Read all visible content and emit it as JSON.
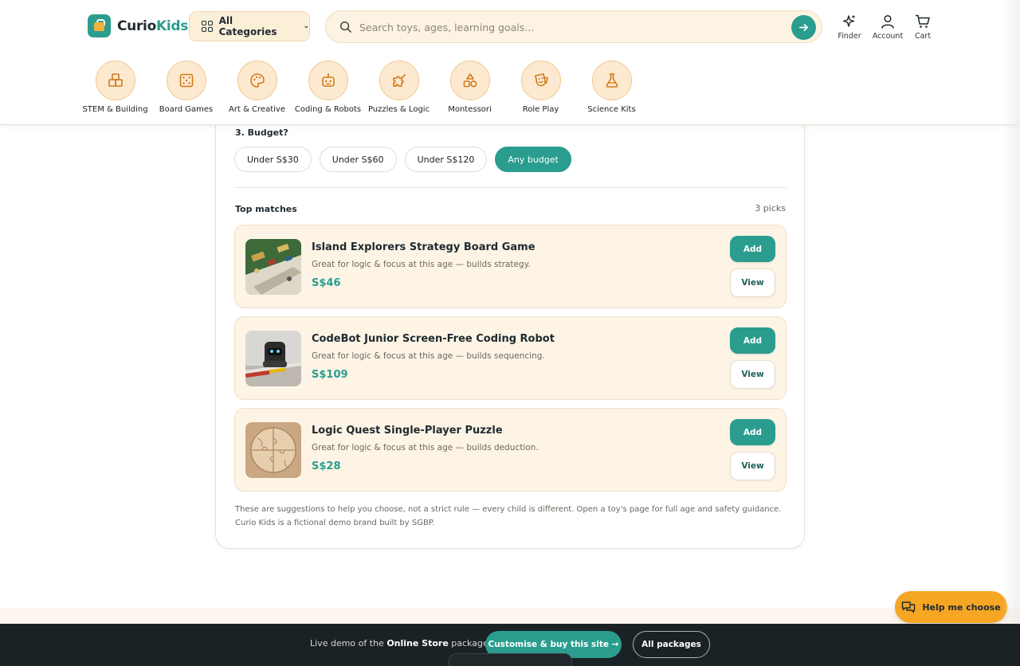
{
  "brand": {
    "part1": "Curio",
    "part2": "Kids"
  },
  "header": {
    "categories_button": "All Categories",
    "search_placeholder": "Search toys, ages, learning goals...",
    "icons": {
      "finder": "Finder",
      "account": "Account",
      "cart": "Cart"
    }
  },
  "categories": [
    {
      "label": "STEM & Building",
      "icon": "blocks-icon"
    },
    {
      "label": "Board Games",
      "icon": "dice-icon"
    },
    {
      "label": "Art & Creative",
      "icon": "palette-icon"
    },
    {
      "label": "Coding & Robots",
      "icon": "robot-icon"
    },
    {
      "label": "Puzzles & Logic",
      "icon": "puzzle-icon"
    },
    {
      "label": "Montessori",
      "icon": "shapes-icon"
    },
    {
      "label": "Role Play",
      "icon": "mask-icon"
    },
    {
      "label": "Science Kits",
      "icon": "flask-icon"
    }
  ],
  "quiz": {
    "question": "3. Budget?",
    "options": [
      "Under S$30",
      "Under S$60",
      "Under S$120",
      "Any budget"
    ],
    "selected": "Any budget"
  },
  "results": {
    "title": "Top matches",
    "count": "3 picks",
    "items": [
      {
        "name": "Island Explorers Strategy Board Game",
        "desc": "Great for logic & focus at this age — builds strategy.",
        "price": "S$46",
        "add": "Add",
        "view": "View"
      },
      {
        "name": "CodeBot Junior Screen-Free Coding Robot",
        "desc": "Great for logic & focus at this age — builds sequencing.",
        "price": "S$109",
        "add": "Add",
        "view": "View"
      },
      {
        "name": "Logic Quest Single-Player Puzzle",
        "desc": "Great for logic & focus at this age — builds deduction.",
        "price": "S$28",
        "add": "Add",
        "view": "View"
      }
    ],
    "disclaimer": "These are suggestions to help you choose, not a strict rule — every child is different. Open a toy's page for full age and safety guidance. Curio Kids is a fictional demo brand built by SGBP."
  },
  "help_button": "Help me choose",
  "footer": {
    "text_prefix": "Live demo of the ",
    "text_bold": "Online Store",
    "text_suffix": " package.",
    "buy_button": "Customise & buy this site →",
    "packages_button": "All packages"
  },
  "colors": {
    "accent": "#2a9d8f",
    "cream": "#fdf4e6",
    "help": "#f5a623",
    "footer": "#1b2226"
  }
}
